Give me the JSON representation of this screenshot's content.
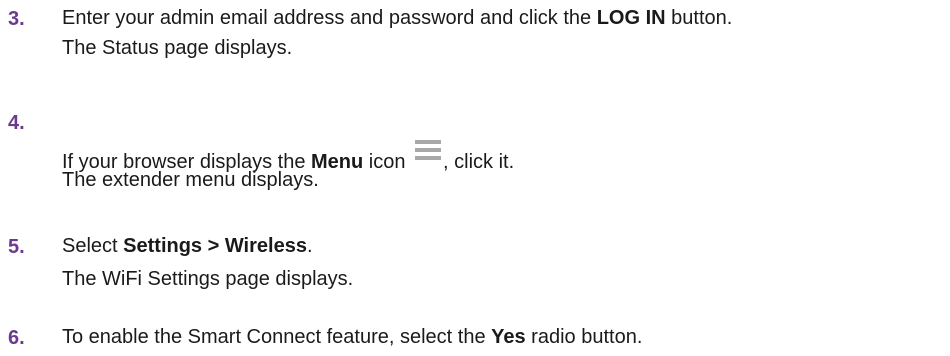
{
  "steps": [
    {
      "number": "3.",
      "pre": "Enter your admin email address and password and click the ",
      "bold": "LOG IN",
      "post": " button.",
      "result": "The Status page displays."
    },
    {
      "number": "4.",
      "pre": "If your browser displays the ",
      "bold": "Menu",
      "mid": " icon ",
      "icon": "hamburger-menu-icon",
      "post": ", click it.",
      "result": "The extender menu displays."
    },
    {
      "number": "5.",
      "pre": "Select ",
      "bold": "Settings > Wireless",
      "post": ".",
      "result": "The WiFi Settings page displays."
    },
    {
      "number": "6.",
      "pre": "To enable the Smart Connect feature, select the ",
      "bold": "Yes",
      "post": " radio button."
    }
  ]
}
